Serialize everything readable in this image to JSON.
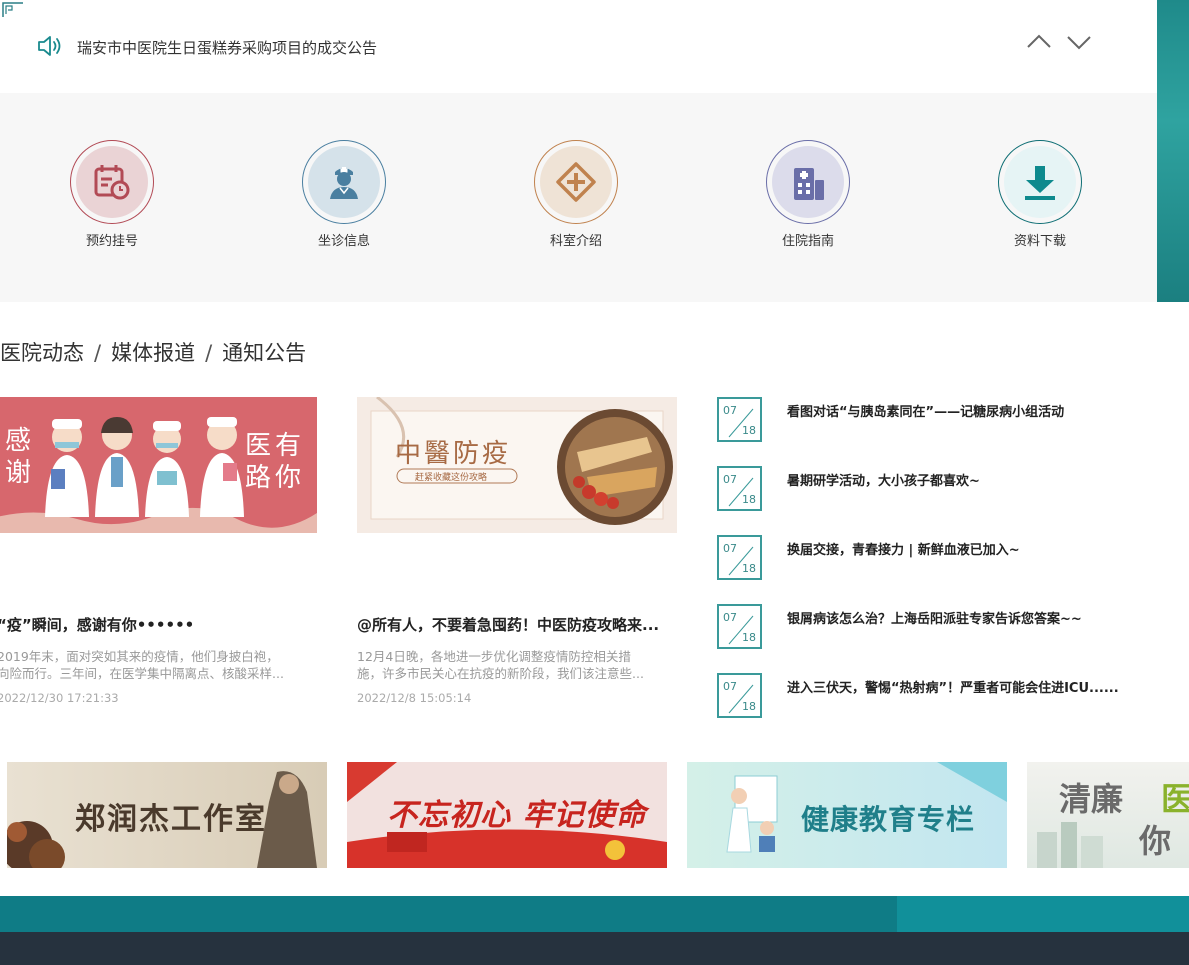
{
  "notice": {
    "text": "瑞安市中医院生日蛋糕券采购项目的成交公告"
  },
  "services": [
    {
      "label": "预约挂号",
      "icon": "calendar-clock-icon",
      "color": "#b24a55"
    },
    {
      "label": "坐诊信息",
      "icon": "nurse-icon",
      "color": "#4a7fa0"
    },
    {
      "label": "科室介绍",
      "icon": "plus-cross-icon",
      "color": "#c0824e"
    },
    {
      "label": "住院指南",
      "icon": "hospital-building-icon",
      "color": "#6a6ea8"
    },
    {
      "label": "资料下载",
      "icon": "download-icon",
      "color": "#0e8a8e"
    }
  ],
  "section_tabs": [
    "医院动态",
    "媒体报道",
    "通知公告"
  ],
  "section_sep": "/",
  "cards": [
    {
      "title": "“疫”瞬间，感谢有你••••••",
      "desc_1": "2019年末，面对突如其来的疫情，他们身披白袍，",
      "desc_2": "向险而行。三年间，在医学集中隔离点、核酸采样...",
      "time": "2022/12/30 17:21:33",
      "img_left": "感谢",
      "img_right_1": "医有",
      "img_right_2": "路你"
    },
    {
      "title": "@所有人，不要着急囤药！中医防疫攻略来...",
      "desc_1": "12月4日晚，各地进一步优化调整疫情防控相关措",
      "desc_2": "施，许多市民关心在抗疫的新阶段，我们该注意些...",
      "time": "2022/12/8 15:05:14",
      "img_title": "中醫防疫",
      "img_sub": "赶紧收藏这份攻略"
    }
  ],
  "notices": [
    {
      "month": "07",
      "day": "18",
      "title": "看图对话“与胰岛素同在”——记糖尿病小组活动"
    },
    {
      "month": "07",
      "day": "18",
      "title": "暑期研学活动，大小孩子都喜欢~"
    },
    {
      "month": "07",
      "day": "18",
      "title": "换届交接，青春接力 | 新鲜血液已加入~"
    },
    {
      "month": "07",
      "day": "18",
      "title": "银屑病该怎么治？上海岳阳派驻专家告诉您答案~~"
    },
    {
      "month": "07",
      "day": "18",
      "title": "进入三伏天，警惕“热射病”！严重者可能会住进ICU......"
    }
  ],
  "banners": [
    {
      "text": "郑润杰工作室"
    },
    {
      "text": "不忘初心 牢记使命"
    },
    {
      "text": "健康教育专栏"
    },
    {
      "text_1": "清廉",
      "text_2": "医",
      "text_3": "你我"
    }
  ]
}
